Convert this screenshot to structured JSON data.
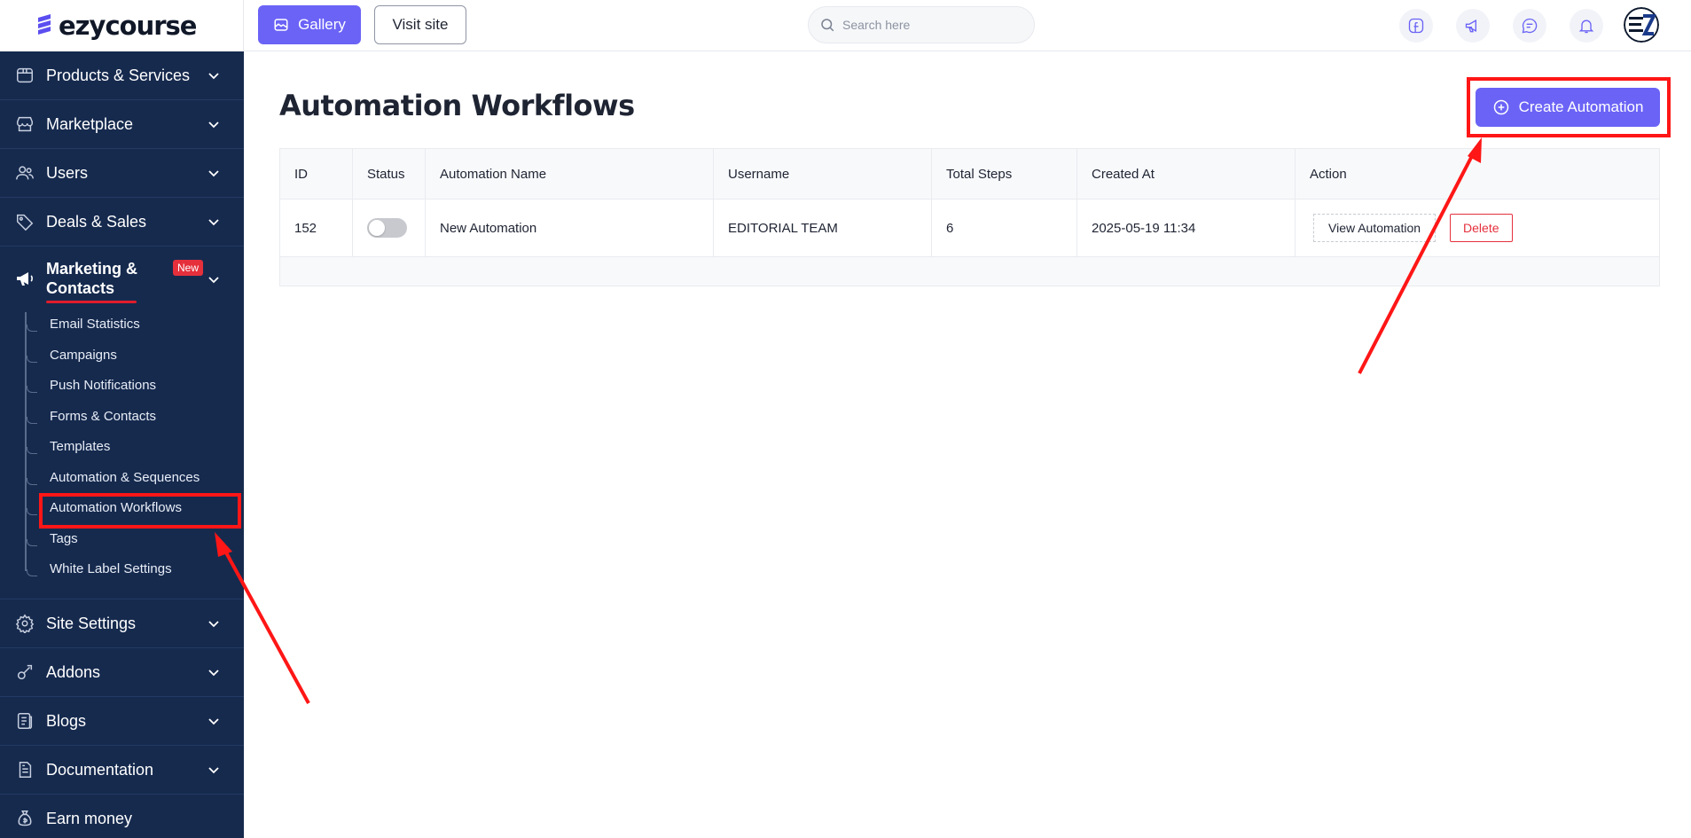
{
  "brand": {
    "name": "ezycourse"
  },
  "topbar": {
    "gallery_label": "Gallery",
    "visit_label": "Visit site",
    "search_placeholder": "Search here"
  },
  "sidebar": {
    "items": [
      {
        "label": "Products & Services",
        "icon": "box-icon"
      },
      {
        "label": "Marketplace",
        "icon": "store-icon"
      },
      {
        "label": "Users",
        "icon": "users-icon"
      },
      {
        "label": "Deals & Sales",
        "icon": "tag-icon"
      }
    ],
    "marketing": {
      "label_line1": "Marketing &",
      "label_line2": "Contacts",
      "badge": "New",
      "icon": "megaphone-icon"
    },
    "sub_items": [
      "Email Statistics",
      "Campaigns",
      "Push Notifications",
      "Forms & Contacts",
      "Templates",
      "Automation & Sequences",
      "Automation Workflows",
      "Tags",
      "White Label Settings"
    ],
    "bottom_items": [
      {
        "label": "Site Settings",
        "icon": "settings-icon"
      },
      {
        "label": "Addons",
        "icon": "addons-icon"
      },
      {
        "label": "Blogs",
        "icon": "blog-icon"
      },
      {
        "label": "Documentation",
        "icon": "document-icon"
      },
      {
        "label": "Earn money",
        "icon": "money-bag-icon"
      }
    ]
  },
  "main": {
    "title": "Automation Workflows",
    "create_label": "Create Automation",
    "table": {
      "headers": [
        "ID",
        "Status",
        "Automation Name",
        "Username",
        "Total Steps",
        "Created At",
        "Action"
      ],
      "rows": [
        {
          "id": "152",
          "status": "off",
          "name": "New Automation",
          "username": "EDITORIAL TEAM",
          "steps": "6",
          "created": "2025-05-19 11:34",
          "view_label": "View Automation",
          "delete_label": "Delete"
        }
      ]
    }
  },
  "colors": {
    "sidebar_bg": "#162a4e",
    "accent": "#6b63f6",
    "highlight": "#ff1616",
    "danger": "#e5303c"
  }
}
